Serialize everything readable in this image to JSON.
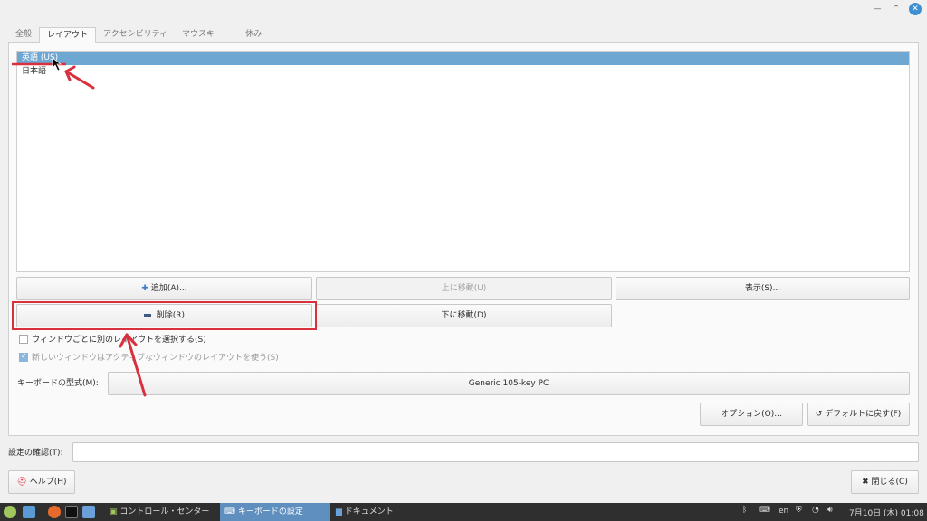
{
  "tabs": [
    "全般",
    "レイアウト",
    "アクセシビリティ",
    "マウスキー",
    "一休み"
  ],
  "active_tab": 1,
  "layouts": [
    {
      "label": "英語 (US)",
      "selected": true
    },
    {
      "label": "日本語",
      "selected": false
    }
  ],
  "buttons": {
    "add": "追加(A)...",
    "move_up": "上に移動(U)",
    "show": "表示(S)...",
    "remove": "削除(R)",
    "move_down": "下に移動(D)",
    "options": "オプション(O)...",
    "reset_default": "デフォルトに戻す(F)",
    "help": "ヘルプ(H)",
    "close": "閉じる(C)"
  },
  "checkboxes": {
    "per_window": {
      "label": "ウィンドウごとに別のレイアウトを選択する(S)",
      "checked": false
    },
    "new_window": {
      "label": "新しいウィンドウはアクティブなウィンドウのレイアウトを使う(S)",
      "checked": true
    }
  },
  "keyboard_model": {
    "label": "キーボードの型式(M):",
    "value": "Generic 105-key PC"
  },
  "test_field": {
    "label": "設定の確認(T):",
    "value": ""
  },
  "taskbar": {
    "items": [
      "コントロール・センター",
      "キーボードの設定",
      "ドキュメント"
    ],
    "active_index": 1,
    "lang": "en",
    "clock": "7月10日 (木) 01:08"
  },
  "colors": {
    "selection": "#6fa7d3",
    "annotation": "#d8303d",
    "taskbar_active": "#5e8fbf"
  }
}
